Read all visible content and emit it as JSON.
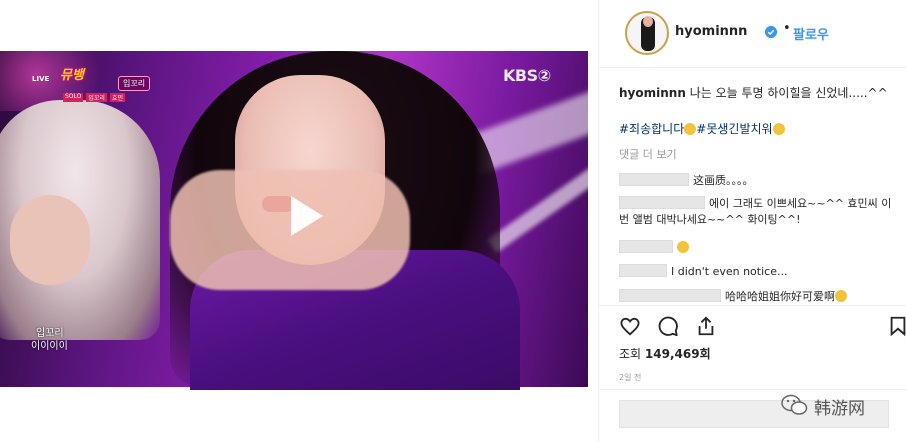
{
  "video": {
    "live_label": "LIVE",
    "show_logo": "뮤뱅",
    "song_title": "입꼬리",
    "sub_labels": [
      "SOLO",
      "입꼬리",
      "효민"
    ],
    "broadcaster": "KBS②",
    "caption_line1": "입꼬리",
    "caption_line2": "이이이이"
  },
  "header": {
    "username": "hyominnn",
    "separator": "•",
    "follow_label": "팔로우"
  },
  "caption": {
    "username": "hyominnn",
    "text": "나는 오늘 투명 하이힐을 신었네.....^^",
    "hashtags": "#죄송합니다",
    "hashtag2": "#못생긴발치워"
  },
  "view_comments_label": "댓글 더 보기",
  "comments": [
    {
      "text": "这画质。。。。"
    },
    {
      "text": "에이 그래도 이쁘세요~~^^ 효민씨 이번 앨범 대박나세요~~^^ 화이팅^^!"
    },
    {
      "text": ""
    },
    {
      "text": "I didn't even notice..."
    },
    {
      "text": "哈哈哈姐姐你好可爱啊"
    }
  ],
  "views": {
    "label": "조회",
    "count": "149,469회"
  },
  "time_ago": "2일 전",
  "watermark": "韩游网",
  "colors": {
    "accent": "#3897f0",
    "hashtag": "#003569"
  }
}
